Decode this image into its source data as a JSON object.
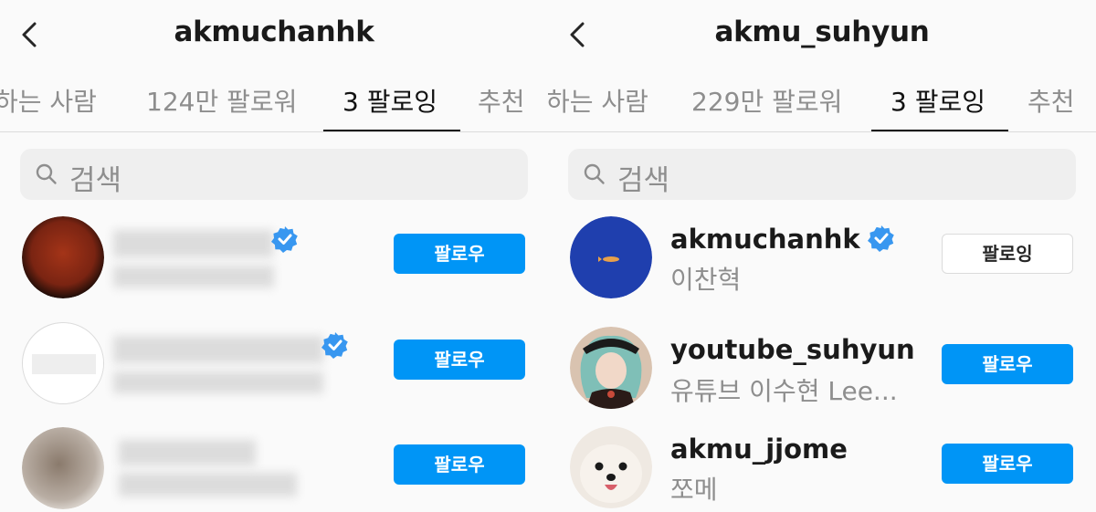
{
  "left": {
    "title": "akmuchanhk",
    "tabs": {
      "followers_suffix": "하는 사람",
      "followers": "124만 팔로워",
      "following": "3 팔로잉",
      "suggested": "추천"
    },
    "search_placeholder": "검색",
    "rows": [
      {
        "button": "팔로우"
      },
      {
        "button": "팔로우"
      },
      {
        "button": "팔로우"
      }
    ]
  },
  "right": {
    "title": "akmu_suhyun",
    "tabs": {
      "followers_suffix": "하는 사람",
      "followers": "229만 팔로워",
      "following": "3 팔로잉",
      "suggested": "추천"
    },
    "search_placeholder": "검색",
    "rows": [
      {
        "username": "akmuchanhk",
        "name": "이찬혁",
        "verified": true,
        "button": "팔로잉"
      },
      {
        "username": "youtube_suhyun",
        "name": "유튜브 이수현 Lee...",
        "verified": false,
        "button": "팔로우"
      },
      {
        "username": "akmu_jjome",
        "name": "쪼메",
        "verified": false,
        "button": "팔로우"
      }
    ]
  },
  "colors": {
    "primary_button": "#0095f6",
    "verified": "#3897f0",
    "muted_text": "#8e8e8e"
  },
  "icons": {
    "back": "chevron-left-icon",
    "search": "search-icon",
    "verified": "verified-badge-icon"
  }
}
